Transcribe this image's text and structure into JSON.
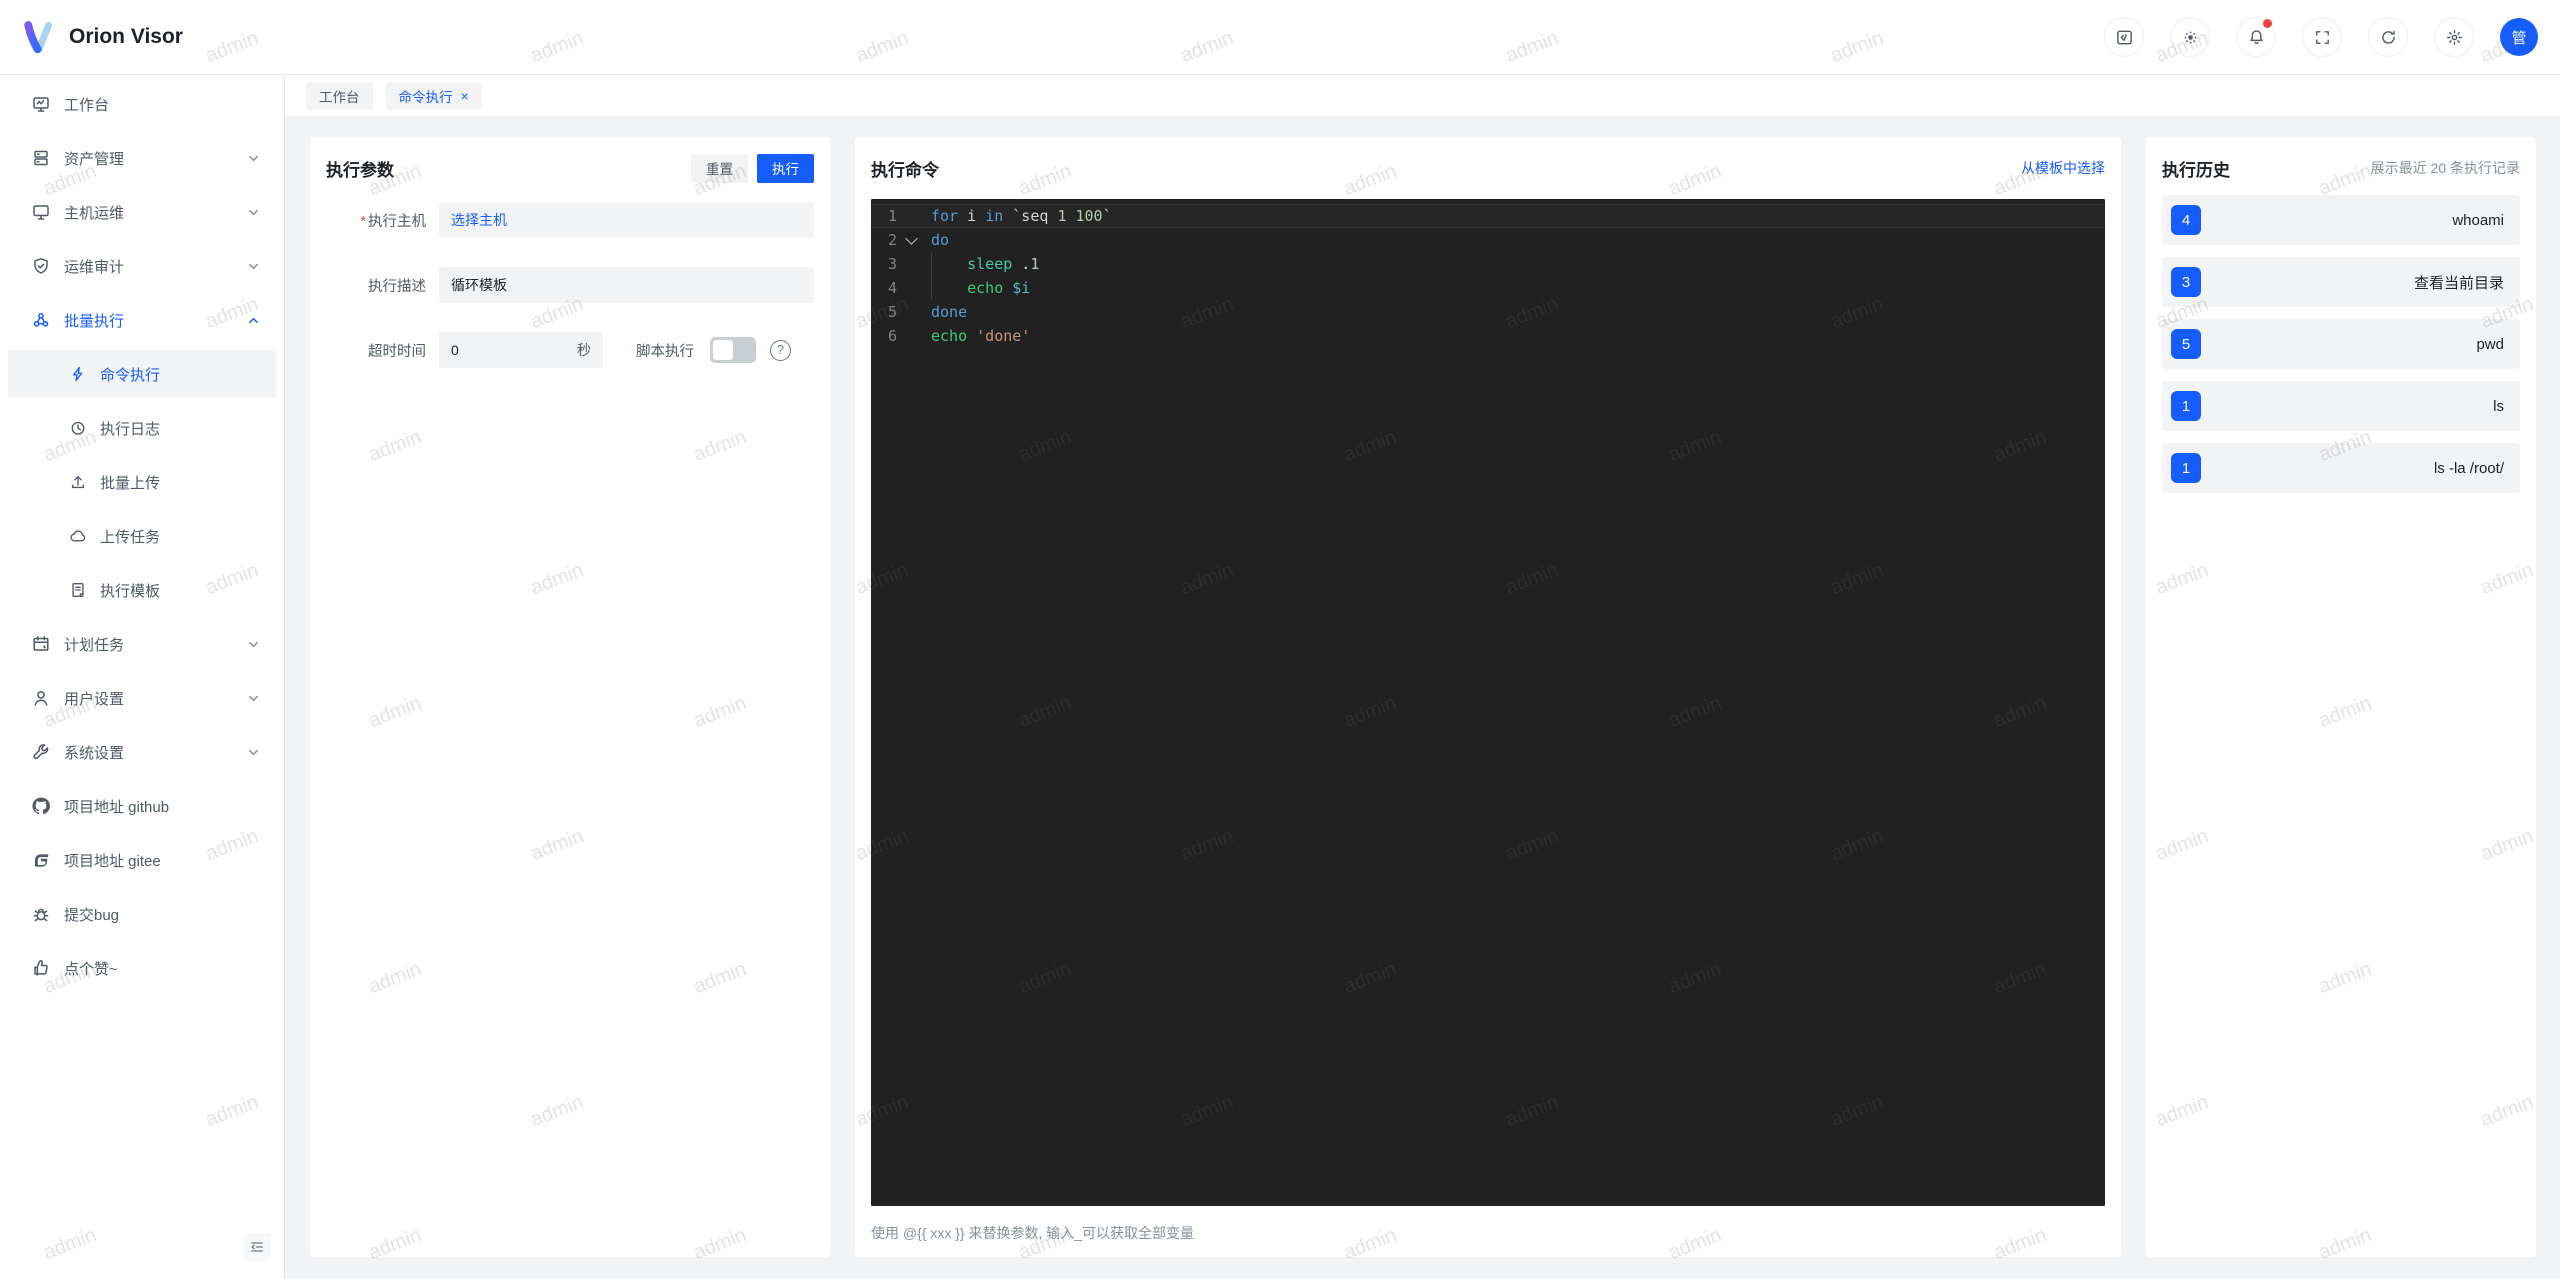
{
  "app": {
    "name": "Orion Visor",
    "avatar": "管"
  },
  "header": {
    "actions": [
      {
        "name": "code-window-icon"
      },
      {
        "name": "theme-icon"
      },
      {
        "name": "notifications-icon",
        "dot": true
      },
      {
        "name": "fullscreen-icon"
      },
      {
        "name": "refresh-icon"
      },
      {
        "name": "settings-icon"
      }
    ]
  },
  "tabs": [
    {
      "label": "工作台",
      "active": false,
      "closable": false
    },
    {
      "label": "命令执行",
      "active": true,
      "closable": true
    }
  ],
  "sidebar": {
    "items": [
      {
        "label": "工作台",
        "icon": "workbench",
        "level": 1
      },
      {
        "label": "资产管理",
        "icon": "assets",
        "level": 1,
        "chevron": "down"
      },
      {
        "label": "主机运维",
        "icon": "host-ops",
        "level": 1,
        "chevron": "down"
      },
      {
        "label": "运维审计",
        "icon": "audit",
        "level": 1,
        "chevron": "down"
      },
      {
        "label": "批量执行",
        "icon": "batch-exec",
        "level": 1,
        "chevron": "up",
        "highlight": true
      },
      {
        "label": "命令执行",
        "icon": "bolt",
        "level": 2,
        "active": true
      },
      {
        "label": "执行日志",
        "icon": "exec-log",
        "level": 2
      },
      {
        "label": "批量上传",
        "icon": "batch-upload",
        "level": 2
      },
      {
        "label": "上传任务",
        "icon": "upload-task",
        "level": 2
      },
      {
        "label": "执行模板",
        "icon": "exec-template",
        "level": 2
      },
      {
        "label": "计划任务",
        "icon": "schedule",
        "level": 1,
        "chevron": "down"
      },
      {
        "label": "用户设置",
        "icon": "user",
        "level": 1,
        "chevron": "down"
      },
      {
        "label": "系统设置",
        "icon": "system",
        "level": 1,
        "chevron": "down"
      },
      {
        "label": "项目地址 github",
        "icon": "github",
        "level": 1
      },
      {
        "label": "项目地址 gitee",
        "icon": "gitee",
        "level": 1
      },
      {
        "label": "提交bug",
        "icon": "bug",
        "level": 1
      },
      {
        "label": "点个赞~",
        "icon": "thumbs-up",
        "level": 1
      }
    ]
  },
  "params": {
    "title": "执行参数",
    "reset": "重置",
    "run": "执行",
    "host_label": "执行主机",
    "host_value": "选择主机",
    "desc_label": "执行描述",
    "desc_value": "循环模板",
    "timeout_label": "超时时间",
    "timeout_value": "0",
    "timeout_suffix": "秒",
    "script_label": "脚本执行",
    "script_enabled": false
  },
  "command": {
    "title": "执行命令",
    "template_link": "从模板中选择",
    "hint": "使用 @{{ xxx }} 来替换参数, 输入_可以获取全部变量",
    "lines": [
      {
        "n": "1",
        "highlight": true,
        "tokens": [
          [
            "kw",
            "for"
          ],
          [
            "pl",
            " i "
          ],
          [
            "kw",
            "in"
          ],
          [
            "pl",
            " `seq "
          ],
          [
            "num",
            "1 100"
          ],
          [
            "pl",
            "`"
          ]
        ]
      },
      {
        "n": "2",
        "fold": true,
        "tokens": [
          [
            "kw",
            "do"
          ]
        ]
      },
      {
        "n": "3",
        "guide": true,
        "tokens": [
          [
            "pl",
            "    "
          ],
          [
            "bi",
            "sleep"
          ],
          [
            "pl",
            " ."
          ],
          [
            "num",
            "1"
          ]
        ]
      },
      {
        "n": "4",
        "guide": true,
        "tokens": [
          [
            "pl",
            "    "
          ],
          [
            "bi2",
            "echo"
          ],
          [
            "pl",
            " "
          ],
          [
            "vr",
            "$i"
          ]
        ]
      },
      {
        "n": "5",
        "tokens": [
          [
            "kw",
            "done"
          ]
        ]
      },
      {
        "n": "6",
        "tokens": [
          [
            "bi2",
            "echo"
          ],
          [
            "pl",
            " "
          ],
          [
            "st",
            "'done'"
          ]
        ]
      }
    ]
  },
  "history": {
    "title": "执行历史",
    "subtitle": "展示最近 20 条执行记录",
    "items": [
      {
        "count": "4",
        "command": "whoami"
      },
      {
        "count": "3",
        "command": "查看当前目录"
      },
      {
        "count": "5",
        "command": "pwd"
      },
      {
        "count": "1",
        "command": "ls"
      },
      {
        "count": "1",
        "command": "ls -la /root/"
      }
    ]
  },
  "watermark": {
    "text": "admin"
  },
  "colors": {
    "primary": "#165dff",
    "danger": "#f53f3f",
    "editor_bg": "#212121",
    "page_bg": "#f2f3f5"
  }
}
